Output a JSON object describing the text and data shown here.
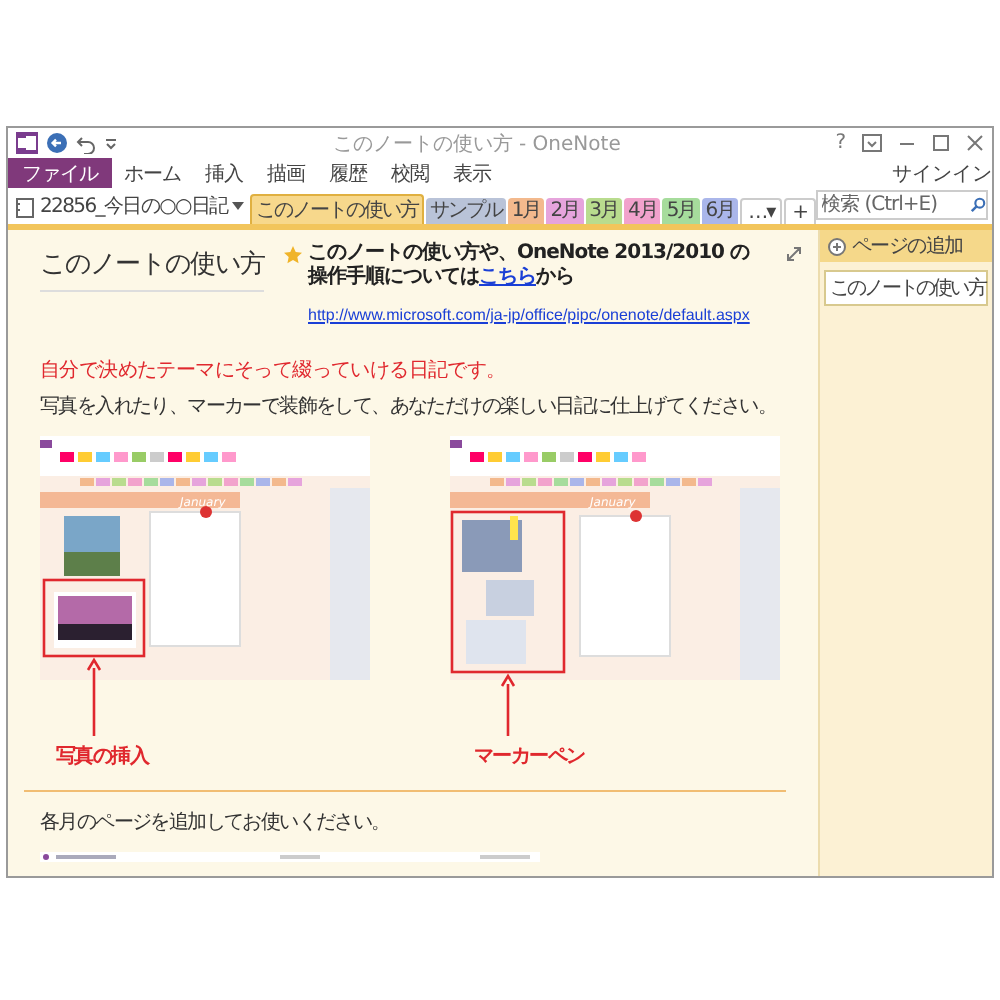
{
  "window": {
    "title": "このノートの使い方 - OneNote",
    "help": "?"
  },
  "ribbon_tabs": [
    {
      "label": "ファイル",
      "kind": "file",
      "selected": false
    },
    {
      "label": "ホーム",
      "kind": "tab",
      "selected": false
    },
    {
      "label": "挿入",
      "kind": "tab",
      "selected": false
    },
    {
      "label": "描画",
      "kind": "tab",
      "selected": false
    },
    {
      "label": "履歴",
      "kind": "tab",
      "selected": false
    },
    {
      "label": "校閲",
      "kind": "tab",
      "selected": false
    },
    {
      "label": "表示",
      "kind": "tab",
      "selected": false
    }
  ],
  "sign_in": "サインイン",
  "notebook": {
    "name": "22856_今日の○○日記"
  },
  "section_tabs": [
    {
      "label": "このノートの使い方",
      "color": "#f7d88c",
      "selected": true
    },
    {
      "label": "サンプル",
      "color": "#b9c3d8",
      "selected": false
    },
    {
      "label": "1月",
      "color": "#f3b98d",
      "selected": false
    },
    {
      "label": "2月",
      "color": "#e6a4dc",
      "selected": false
    },
    {
      "label": "3月",
      "color": "#b9dc8e",
      "selected": false
    },
    {
      "label": "4月",
      "color": "#f2a2cc",
      "selected": false
    },
    {
      "label": "5月",
      "color": "#a6dc9c",
      "selected": false
    },
    {
      "label": "6月",
      "color": "#aab6ea",
      "selected": false
    }
  ],
  "more_tab": "…▾",
  "add_tab": "+",
  "search": {
    "placeholder": "検索 (Ctrl+E)"
  },
  "pages_pane": {
    "add_page": "ページの追加",
    "pages": [
      {
        "title": "このノートの使い方",
        "selected": true
      }
    ]
  },
  "page": {
    "title": "このノートの使い方",
    "note": {
      "before": "このノートの使い方や、OneNote 2013/2010 の操作手順については",
      "link": "こちら",
      "after": "から",
      "url": "http://www.microsoft.com/ja-jp/office/pipc/onenote/default.aspx"
    },
    "lead": "自分で決めたテーマにそって綴っていける日記です。",
    "body": "写真を入れたり、マーカーで装飾をして、あなただけの楽しい日記に仕上げてください。",
    "figures": [
      {
        "kind": "photo",
        "banner": "January",
        "caption": "写真の挿入"
      },
      {
        "kind": "marker",
        "banner": "January",
        "caption": "マーカーペン"
      }
    ],
    "footer": "各月のページを追加してお使いください。"
  }
}
